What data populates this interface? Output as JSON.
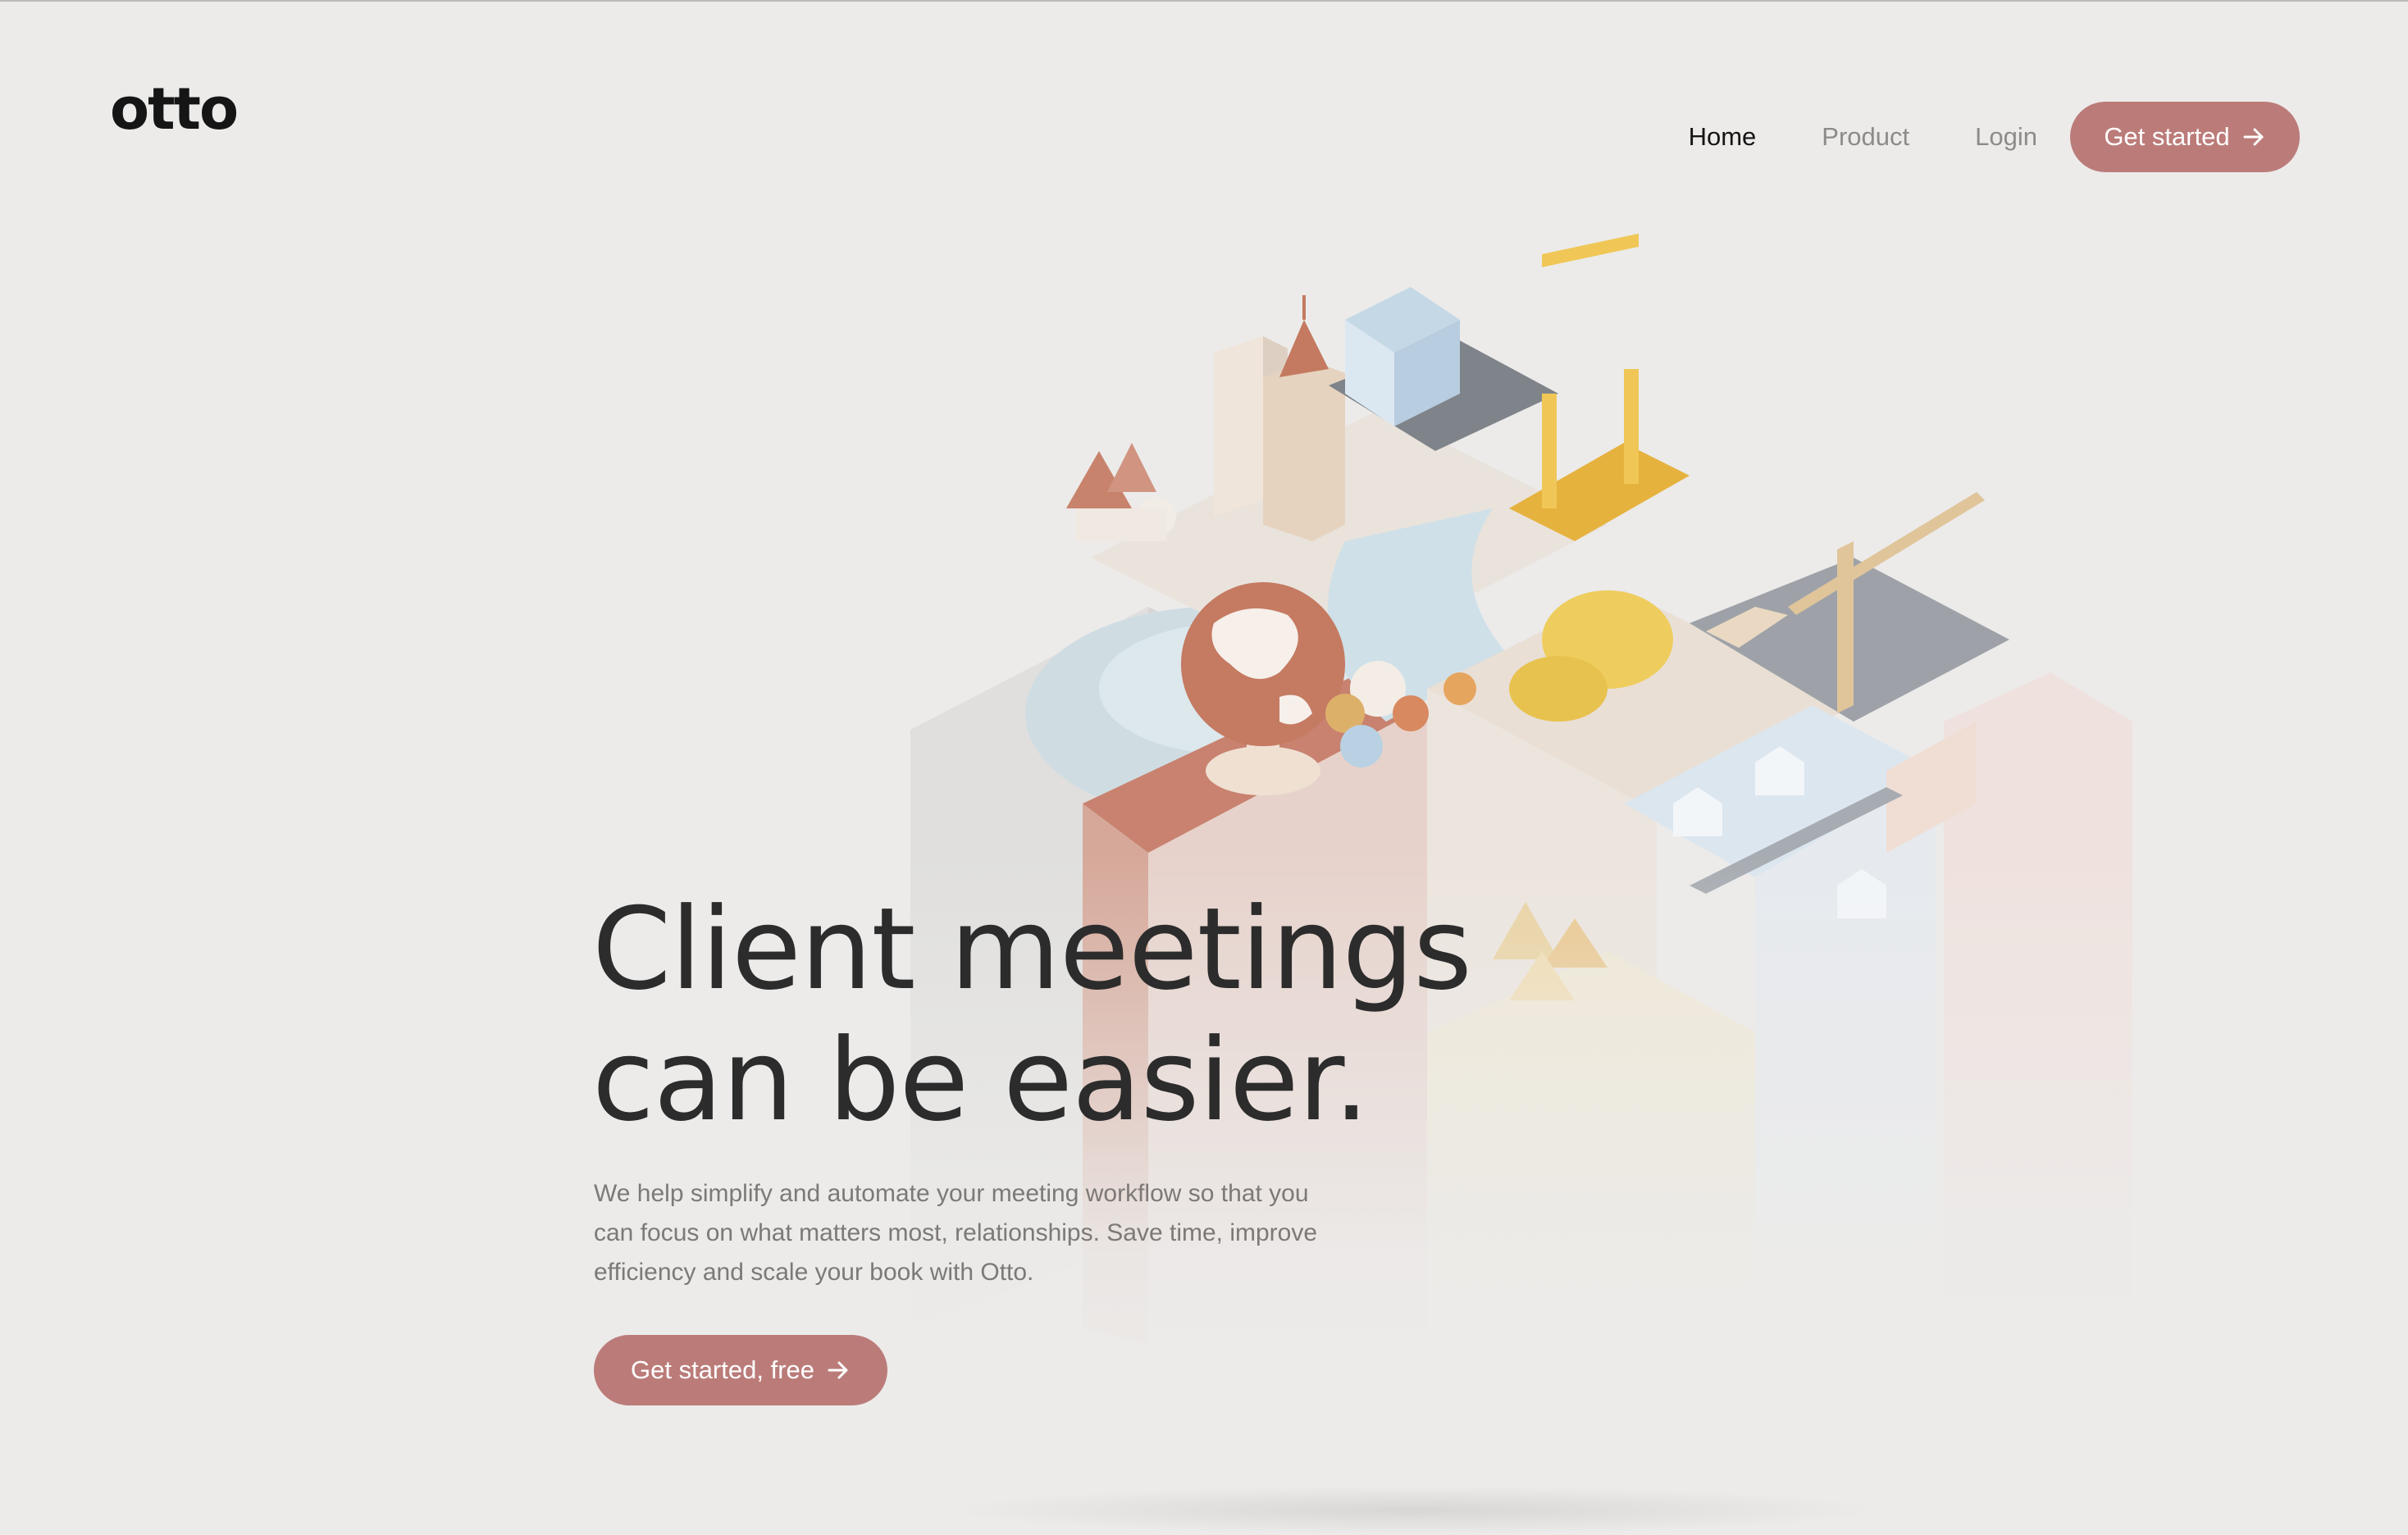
{
  "brand": {
    "logo_text": "otto",
    "accent_color": "#bb7c79"
  },
  "nav": {
    "items": [
      {
        "label": "Home",
        "active": true
      },
      {
        "label": "Product",
        "active": false
      },
      {
        "label": "Login",
        "active": false
      }
    ],
    "cta_label": "Get started",
    "cta_icon": "arrow-right-icon"
  },
  "hero": {
    "title_line1": "Client meetings",
    "title_line2": "can be easier.",
    "description": "We help simplify and automate your meeting workflow so that you can focus on what matters most, relationships. Save time, improve efficiency and scale your book with Otto.",
    "cta_label": "Get started, free",
    "cta_icon": "arrow-right-icon"
  },
  "illustration": {
    "name": "isometric-city-illustration"
  }
}
